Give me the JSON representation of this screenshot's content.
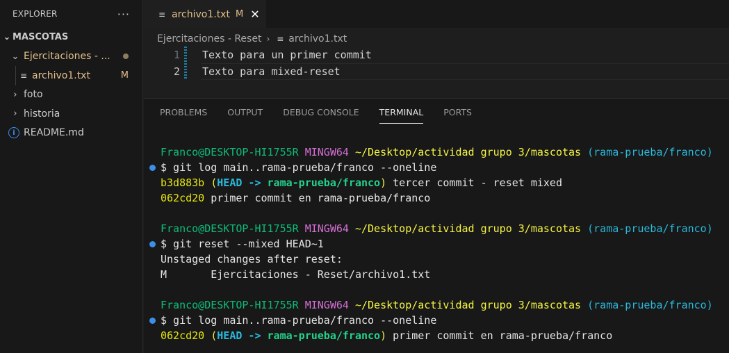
{
  "sidebar": {
    "title": "EXPLORER",
    "more_icon": "more-horizontal-icon",
    "root_label": "MASCOTAS",
    "folder_open_label": "Ejercitaciones - ...",
    "file_label": "archivo1.txt",
    "file_status": "M",
    "folder_foto": "foto",
    "folder_historia": "historia",
    "readme_label": "README.md"
  },
  "tab": {
    "label": "archivo1.txt",
    "status": "M",
    "close": "✕"
  },
  "breadcrumb": {
    "folder": "Ejercitaciones - Reset",
    "sep": "›",
    "file": "archivo1.txt"
  },
  "editor": {
    "lines": [
      {
        "num": "1",
        "text": "Texto para un primer commit"
      },
      {
        "num": "2",
        "text": "Texto para mixed-reset"
      }
    ]
  },
  "panel": {
    "tabs": [
      "PROBLEMS",
      "OUTPUT",
      "DEBUG CONSOLE",
      "TERMINAL",
      "PORTS"
    ],
    "active_tab": "TERMINAL"
  },
  "terminal": {
    "prompt_user": "Franco@DESKTOP-HI1755R",
    "prompt_env": "MINGW64",
    "prompt_path": "~/Desktop/actividad grupo 3/mascotas",
    "prompt_branch": "(rama-prueba/franco)",
    "cmd1": "$ git log main..rama-prueba/franco --oneline",
    "out1_hash": "b3d883b",
    "out1_open": "(",
    "out1_head": "HEAD -> ",
    "out1_branch": "rama-prueba/franco",
    "out1_close": ")",
    "out1_msg": " tercer commit - reset mixed",
    "out2_hash": "062cd20",
    "out2_msg": " primer commit en rama-prueba/franco",
    "cmd2": "$ git reset --mixed HEAD~1",
    "out3": "Unstaged changes after reset:",
    "out4": "M       Ejercitaciones - Reset/archivo1.txt",
    "cmd3": "$ git log main..rama-prueba/franco --oneline",
    "out5_hash": "062cd20",
    "out5_open": "(",
    "out5_head": "HEAD -> ",
    "out5_branch": "rama-prueba/franco",
    "out5_close": ")",
    "out5_msg": " primer commit en rama-prueba/franco"
  },
  "colors": {
    "accent_blue": "#3b8eea",
    "modified": "#e2c08d"
  }
}
